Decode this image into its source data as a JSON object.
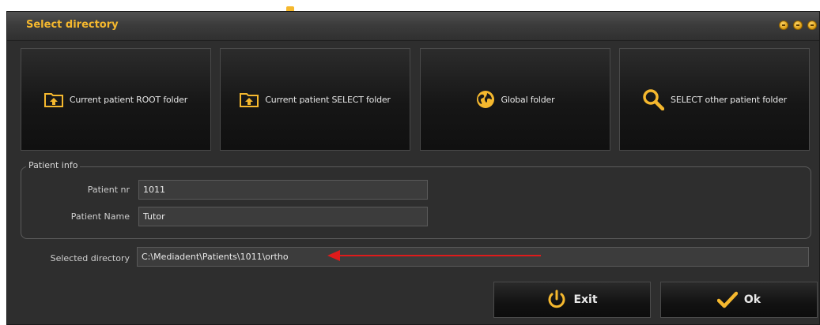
{
  "window": {
    "title": "Select directory"
  },
  "tiles": [
    {
      "label": "Current patient ROOT folder",
      "icon": "folder-up-icon"
    },
    {
      "label": "Current patient SELECT folder",
      "icon": "folder-up-icon"
    },
    {
      "label": "Global folder",
      "icon": "globe-icon"
    },
    {
      "label": "SELECT other patient folder",
      "icon": "search-icon"
    }
  ],
  "patient_info": {
    "group_label": "Patient info",
    "nr_label": "Patient nr",
    "nr_value": "1011",
    "name_label": "Patient Name",
    "name_value": "Tutor"
  },
  "selected_directory": {
    "label": "Selected directory",
    "value": "C:\\Mediadent\\Patients\\1011\\ortho"
  },
  "buttons": {
    "exit_label": "Exit",
    "ok_label": "Ok"
  },
  "colors": {
    "accent": "#f5b82e",
    "annotation_arrow": "#e01b1b"
  }
}
